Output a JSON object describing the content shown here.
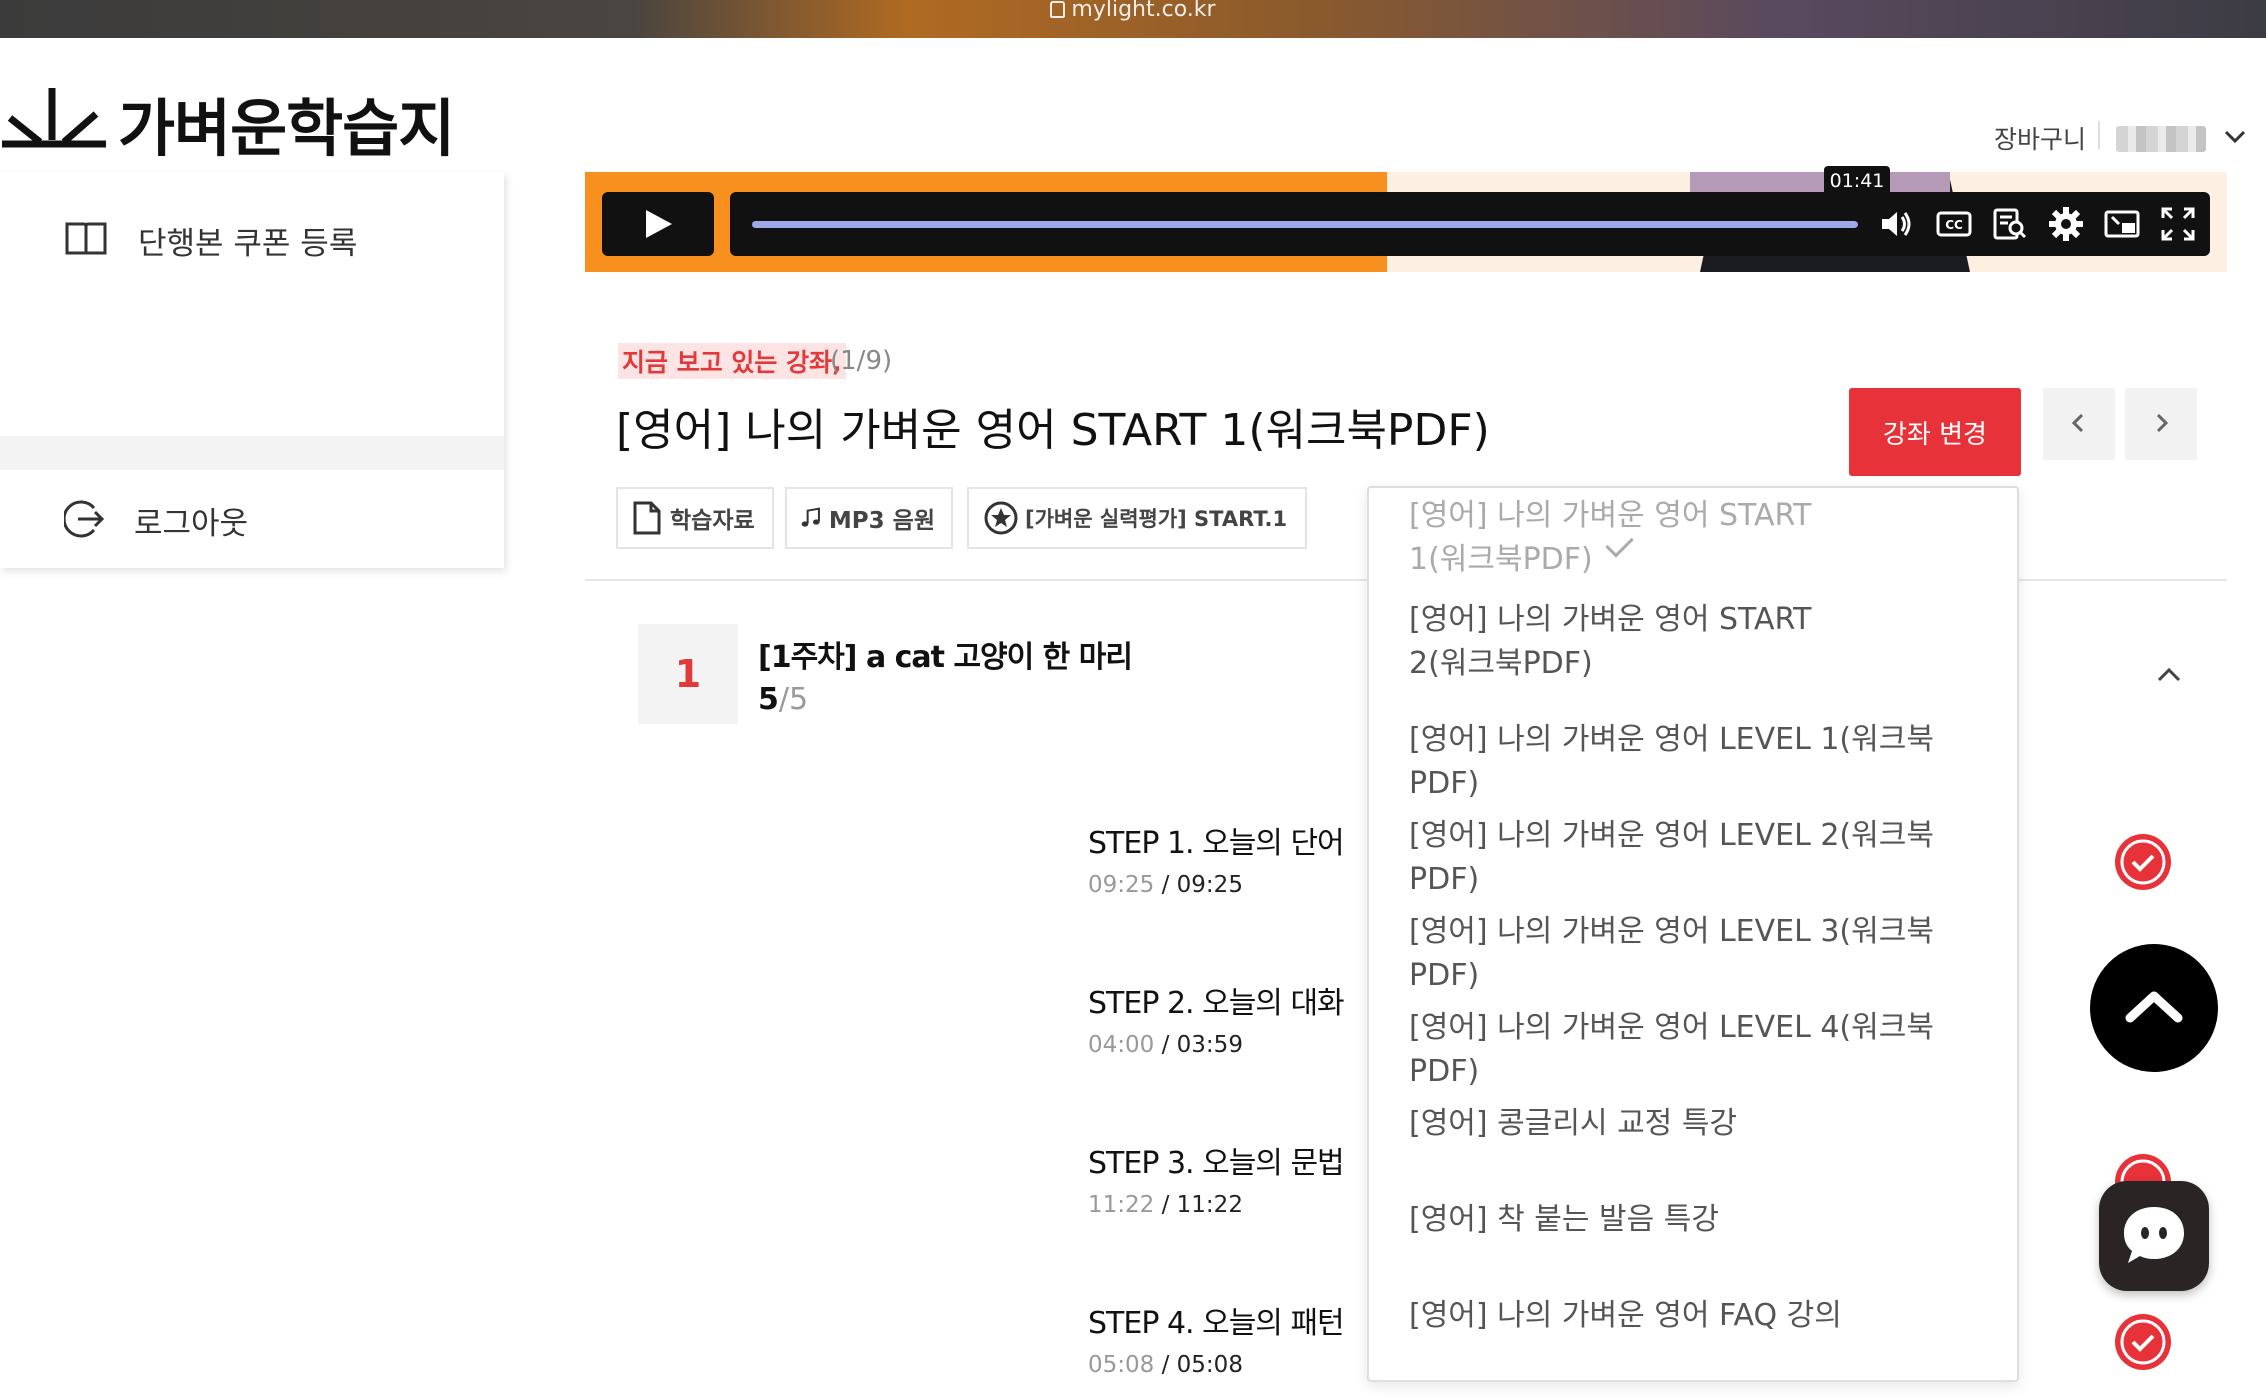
{
  "browser": {
    "url": "mylight.co.kr"
  },
  "header": {
    "logo_text": "가벼운학습지",
    "cart_label": "장바구니"
  },
  "sidebar": {
    "items": [
      {
        "label": "단행본 쿠폰 등록",
        "icon": "book-icon"
      },
      {
        "label": "로그아웃",
        "icon": "logout-icon"
      }
    ]
  },
  "player": {
    "hover_time": "01:41",
    "progress": 0.955,
    "icons": [
      "play-icon",
      "volume-icon",
      "captions-icon",
      "transcript-icon",
      "settings-icon",
      "pip-icon",
      "fullscreen-icon"
    ]
  },
  "lecture": {
    "now_label": "지금 보고 있는 강좌,",
    "count": "(1/9)",
    "title": "[영어] 나의 가벼운 영어 START 1(워크북PDF)",
    "change_button": "강좌 변경",
    "chips": [
      {
        "label": "학습자료",
        "icon": "document-icon"
      },
      {
        "label": "MP3 음원",
        "icon": "music-note-icon"
      },
      {
        "label": "[가벼운 실력평가] START.1",
        "icon": "star-circle-icon"
      }
    ]
  },
  "week": {
    "number": "1",
    "title": "[1주차] a cat 고양이 한 마리",
    "progress_done": "5",
    "progress_total": "/5"
  },
  "steps": [
    {
      "title": "STEP 1. 오늘의 단어",
      "watched": "09:25",
      "total": " / 09:25",
      "done": true
    },
    {
      "title": "STEP 2. 오늘의 대화",
      "watched": "04:00",
      "total": " / 03:59",
      "done": true
    },
    {
      "title": "STEP 3. 오늘의 문법",
      "watched": "11:22",
      "total": " / 11:22",
      "done": true
    },
    {
      "title": "STEP 4. 오늘의 패턴",
      "watched": "05:08",
      "total": " / 05:08",
      "done": true
    }
  ],
  "dropdown": {
    "items": [
      {
        "line1": "[영어] 나의 가벼운 영어 START",
        "line2": "1(워크북PDF)",
        "selected": true
      },
      {
        "line1": "[영어] 나의 가벼운 영어 START",
        "line2": "2(워크북PDF)",
        "selected": false
      },
      {
        "line1": "[영어] 나의 가벼운 영어 LEVEL 1(워크북PDF)",
        "selected": false
      },
      {
        "line1": "[영어] 나의 가벼운 영어 LEVEL 2(워크북PDF)",
        "selected": false
      },
      {
        "line1": "[영어] 나의 가벼운 영어 LEVEL 3(워크북PDF)",
        "selected": false
      },
      {
        "line1": "[영어] 나의 가벼운 영어 LEVEL 4(워크북PDF)",
        "selected": false
      },
      {
        "line1": "[영어] 콩글리시 교정 특강",
        "selected": false
      },
      {
        "line1": "[영어] 착 붙는 발음 특강",
        "selected": false
      },
      {
        "line1": "[영어] 나의 가벼운 영어 FAQ 강의",
        "selected": false
      }
    ]
  },
  "colors": {
    "accent_red": "#e8323a",
    "video_orange": "#f7901e",
    "check_red": "#e8323a"
  }
}
